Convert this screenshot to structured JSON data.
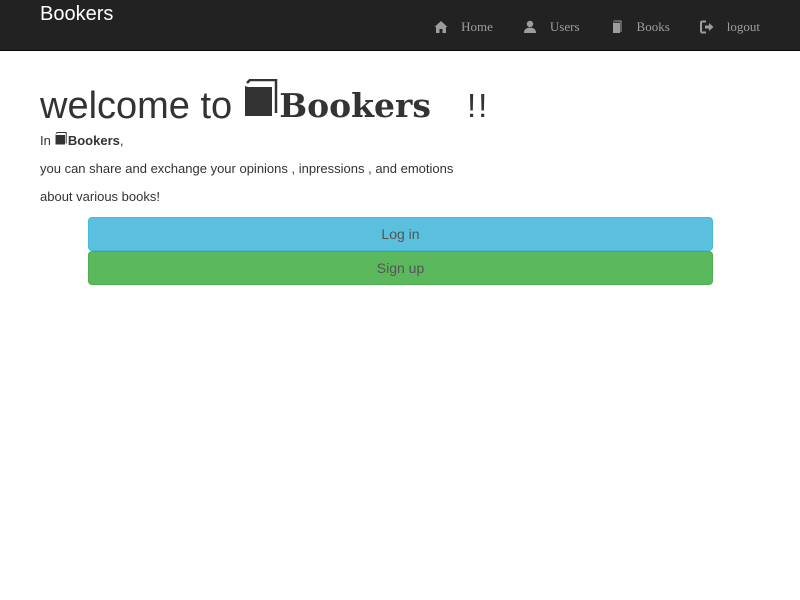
{
  "navbar": {
    "brand": "Bookers",
    "items": [
      {
        "label": "Home",
        "icon": "home-icon"
      },
      {
        "label": "Users",
        "icon": "user-icon"
      },
      {
        "label": "Books",
        "icon": "book-icon"
      },
      {
        "label": "logout",
        "icon": "logout-icon"
      }
    ]
  },
  "hero": {
    "prefix": "welcome to",
    "brand": "Bookers",
    "suffix": "!!"
  },
  "intro": {
    "in_label": "In",
    "brand": "Bookers",
    "comma": ",",
    "line2": "you can share and exchange your opinions , inpressions , and emotions",
    "line3": "about various books!"
  },
  "buttons": {
    "login": "Log in",
    "signup": "Sign up"
  },
  "colors": {
    "navbar_bg": "#222222",
    "nav_text": "#9d9d9d",
    "login_bg": "#5bc0de",
    "signup_bg": "#5cb85c"
  }
}
